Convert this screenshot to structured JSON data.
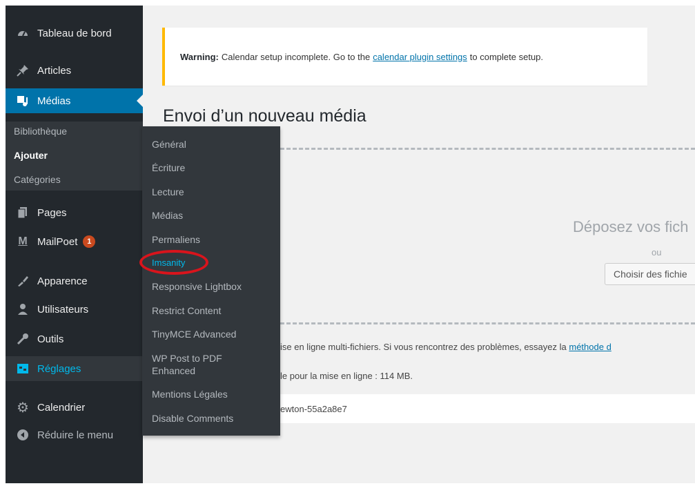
{
  "sidebar": {
    "items": [
      {
        "label": "Tableau de bord",
        "icon": "dashboard-icon"
      },
      {
        "label": "Articles",
        "icon": "pin-icon"
      },
      {
        "label": "Médias",
        "icon": "media-icon"
      },
      {
        "label": "Pages",
        "icon": "page-icon"
      },
      {
        "label": "MailPoet",
        "icon": "mailpoet-icon",
        "badge": "1"
      },
      {
        "label": "Apparence",
        "icon": "appearance-icon"
      },
      {
        "label": "Utilisateurs",
        "icon": "users-icon"
      },
      {
        "label": "Outils",
        "icon": "tools-icon"
      },
      {
        "label": "Réglages",
        "icon": "settings-icon"
      },
      {
        "label": "Calendrier",
        "icon": "gear-icon"
      },
      {
        "label": "Réduire le menu",
        "icon": "collapse-icon"
      }
    ],
    "media_submenu": [
      "Bibliothèque",
      "Ajouter",
      "Catégories"
    ]
  },
  "flyout": [
    "Général",
    "Écriture",
    "Lecture",
    "Médias",
    "Permaliens",
    "Imsanity",
    "Responsive Lightbox",
    "Restrict Content",
    "TinyMCE Advanced",
    "WP Post to PDF Enhanced",
    "Mentions Légales",
    "Disable Comments"
  ],
  "notice": {
    "prefix": "Warning:",
    "before": "Calendar setup incomplete. Go to the",
    "link": "calendar plugin settings",
    "after": "to complete setup."
  },
  "main": {
    "title": "Envoi d’un nouveau média",
    "drop": "Déposez vos fich",
    "or": "ou",
    "choose": "Choisir des fichie",
    "info1": "ise en ligne multi-fichiers. Si vous rencontrez des problèmes, essayez la",
    "info1_link": "méthode d",
    "info2": "le pour la mise en ligne : 114 MB.",
    "file": "ewton-55a2a8e7"
  },
  "colors": {
    "sidebar": "#23282d",
    "accent": "#0073aa",
    "notice_border": "#ffb900",
    "highlight": "#00b9eb",
    "annotation": "#d9141c"
  }
}
